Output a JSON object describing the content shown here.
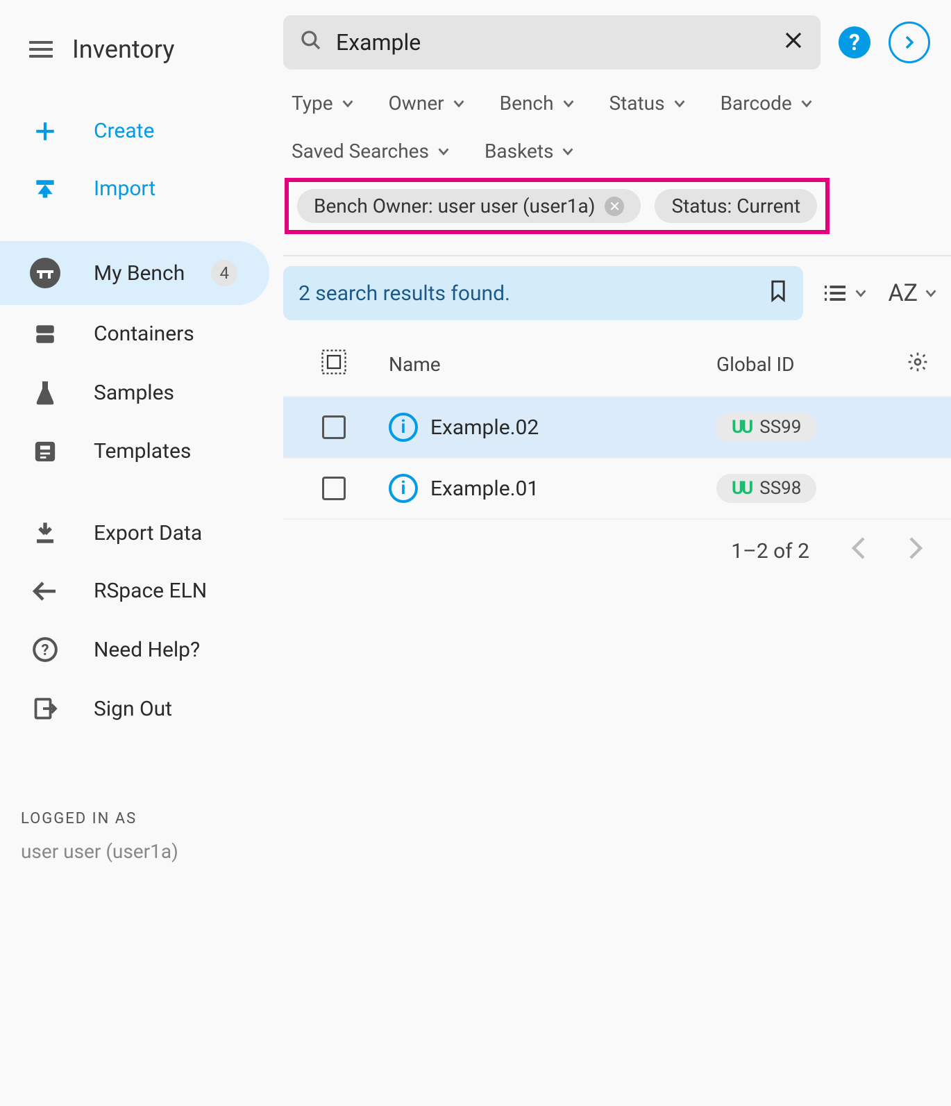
{
  "header": {
    "title": "Inventory"
  },
  "search": {
    "value": "Example"
  },
  "filters": {
    "items": [
      "Type",
      "Owner",
      "Bench",
      "Status",
      "Barcode"
    ],
    "secondRow": [
      "Saved Searches",
      "Baskets"
    ]
  },
  "chips": {
    "benchOwner": "Bench Owner: user user (user1a)",
    "status": "Status: Current"
  },
  "sidebar": {
    "create": "Create",
    "import": "Import",
    "myBench": "My Bench",
    "myBenchBadge": "4",
    "containers": "Containers",
    "samples": "Samples",
    "templates": "Templates",
    "export": "Export Data",
    "eln": "RSpace ELN",
    "help": "Need Help?",
    "signout": "Sign Out"
  },
  "loggedIn": {
    "title": "LOGGED IN AS",
    "user": "user user (user1a)"
  },
  "results": {
    "banner": "2 search results found.",
    "sortLabel": "AZ",
    "columns": {
      "name": "Name",
      "globalId": "Global ID"
    },
    "rows": [
      {
        "name": "Example.02",
        "id": "SS99"
      },
      {
        "name": "Example.01",
        "id": "SS98"
      }
    ],
    "pagination": "1–2 of 2"
  }
}
